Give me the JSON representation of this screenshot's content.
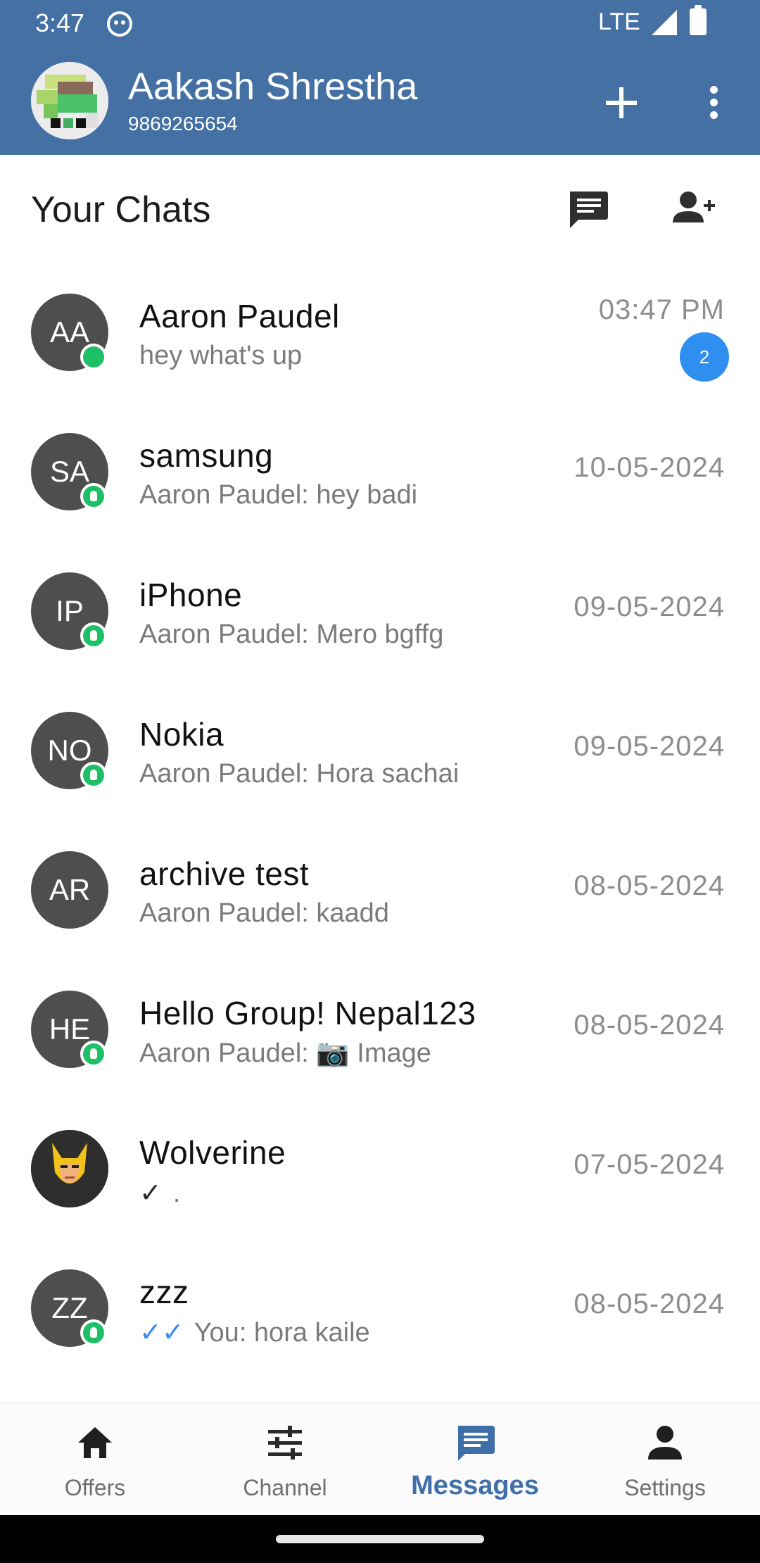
{
  "status_bar": {
    "time": "3:47",
    "network": "LTE"
  },
  "header": {
    "user_name": "Aakash Shrestha",
    "phone": "9869265654"
  },
  "section": {
    "title": "Your Chats"
  },
  "chats": [
    {
      "initials": "AA",
      "name": "Aaron Paudel",
      "message": "hey what's up",
      "time": "03:47 PM",
      "unread": "2"
    },
    {
      "initials": "SA",
      "name": "samsung",
      "message": "Aaron Paudel: hey badi",
      "time": "10-05-2024"
    },
    {
      "initials": "IP",
      "name": "iPhone",
      "message": "Aaron Paudel: Mero bgffg",
      "time": "09-05-2024"
    },
    {
      "initials": "NO",
      "name": "Nokia",
      "message": "Aaron Paudel: Hora sachai",
      "time": "09-05-2024"
    },
    {
      "initials": "AR",
      "name": "archive test",
      "message": "Aaron Paudel: kaadd",
      "time": "08-05-2024"
    },
    {
      "initials": "HE",
      "name": "Hello Group! Nepal123",
      "message_prefix": "Aaron Paudel: ",
      "message_icon": "📷",
      "message_suffix": " Image",
      "time": "08-05-2024"
    },
    {
      "initials": "",
      "name": "Wolverine",
      "message": ".",
      "time": "07-05-2024"
    },
    {
      "initials": "ZZ",
      "name": "zzz",
      "message": "You: hora kaile",
      "time": "08-05-2024"
    }
  ],
  "nav": [
    {
      "label": "Offers",
      "icon": "home-icon"
    },
    {
      "label": "Channel",
      "icon": "tune-icon"
    },
    {
      "label": "Messages",
      "icon": "chat-icon",
      "active": true
    },
    {
      "label": "Settings",
      "icon": "person-icon"
    }
  ],
  "colors": {
    "app_bar": "#4470a4",
    "online": "#1dbf67",
    "badge": "#2e8ff0",
    "nav_active": "#3f6fa8"
  }
}
